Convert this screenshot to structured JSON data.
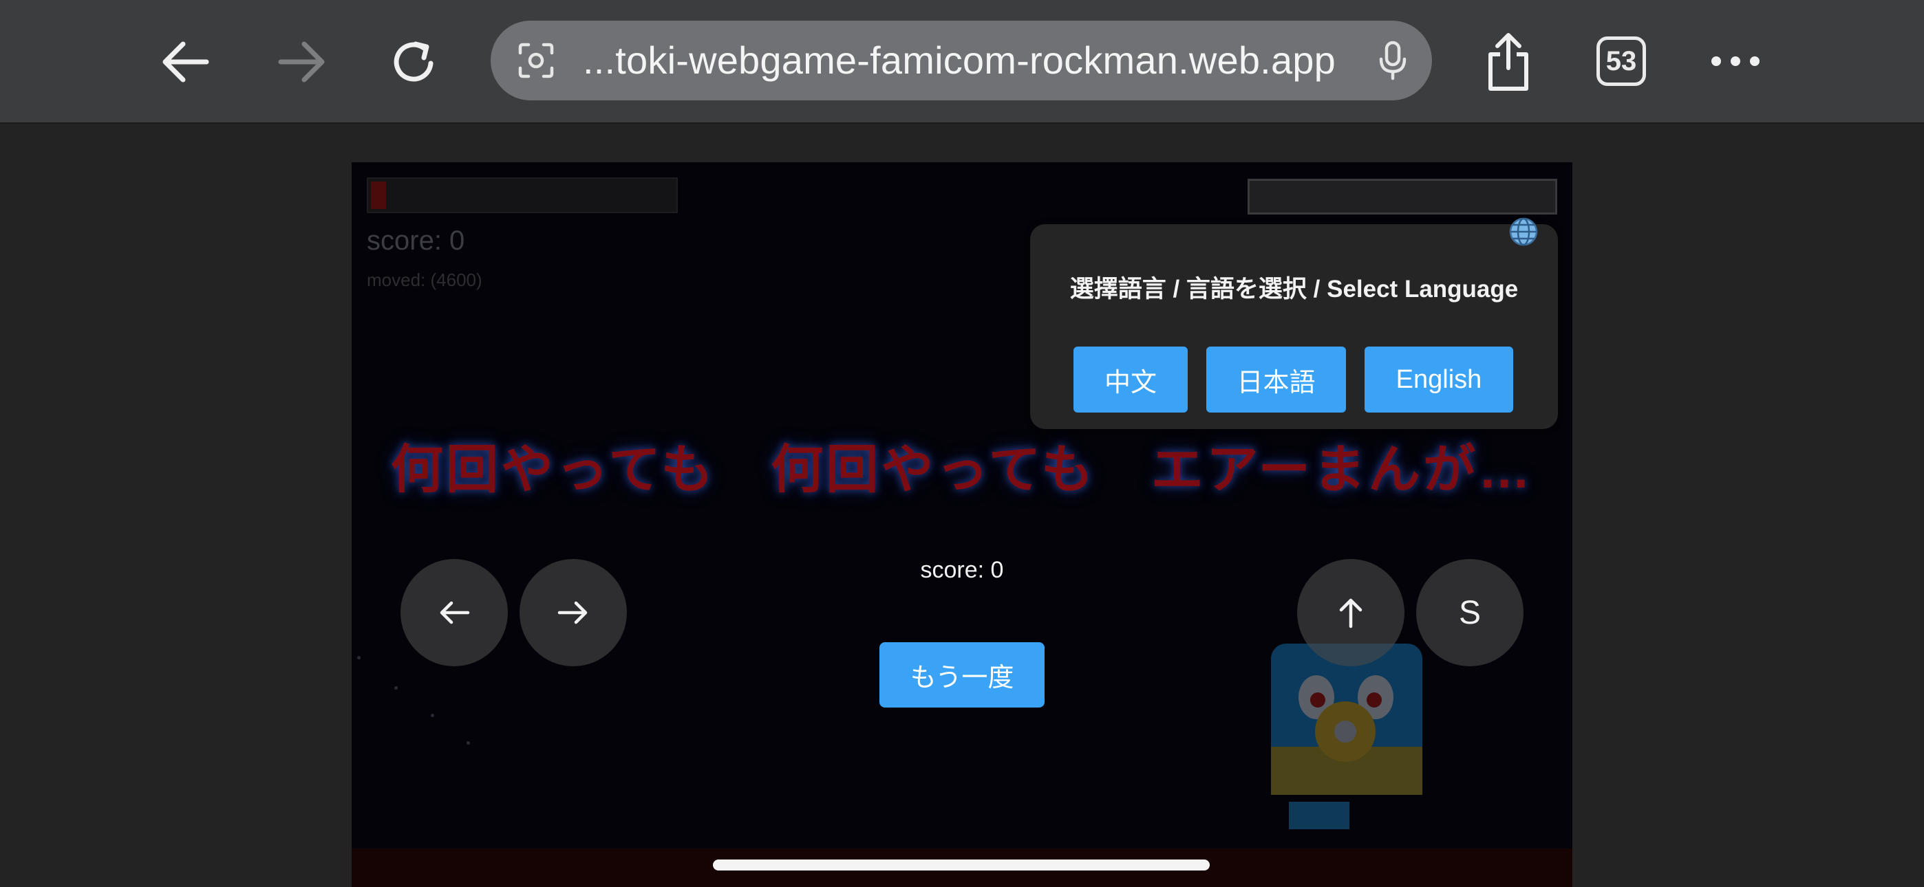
{
  "browser": {
    "url": "...toki-webgame-famicom-rockman.web.app",
    "tab_count": "53",
    "icons": {
      "back": "back-arrow-icon",
      "forward": "forward-arrow-icon",
      "reload": "reload-icon",
      "lens": "lens-camera-icon",
      "mic": "microphone-icon",
      "share": "share-icon",
      "more": "more-dots-icon"
    }
  },
  "game": {
    "hud_score": "score: 0",
    "hud_moved": "moved: (4600)",
    "player_hp_fraction": 0.05,
    "gameover_text": "何回やっても　何回やっても　エアーまんが…",
    "final_score": "score: 0",
    "retry_label": "もう一度",
    "controls": {
      "left": "←",
      "right": "→",
      "jump": "↑",
      "shoot": "S"
    }
  },
  "language_popup": {
    "title": "選擇語言 / 言語を選択 / Select Language",
    "buttons": {
      "zh": "中文",
      "ja": "日本語",
      "en": "English"
    }
  },
  "colors": {
    "accent": "#3aa3f6",
    "gameover_text": "#7c0c12",
    "toolbar": "#3b3d3f"
  }
}
